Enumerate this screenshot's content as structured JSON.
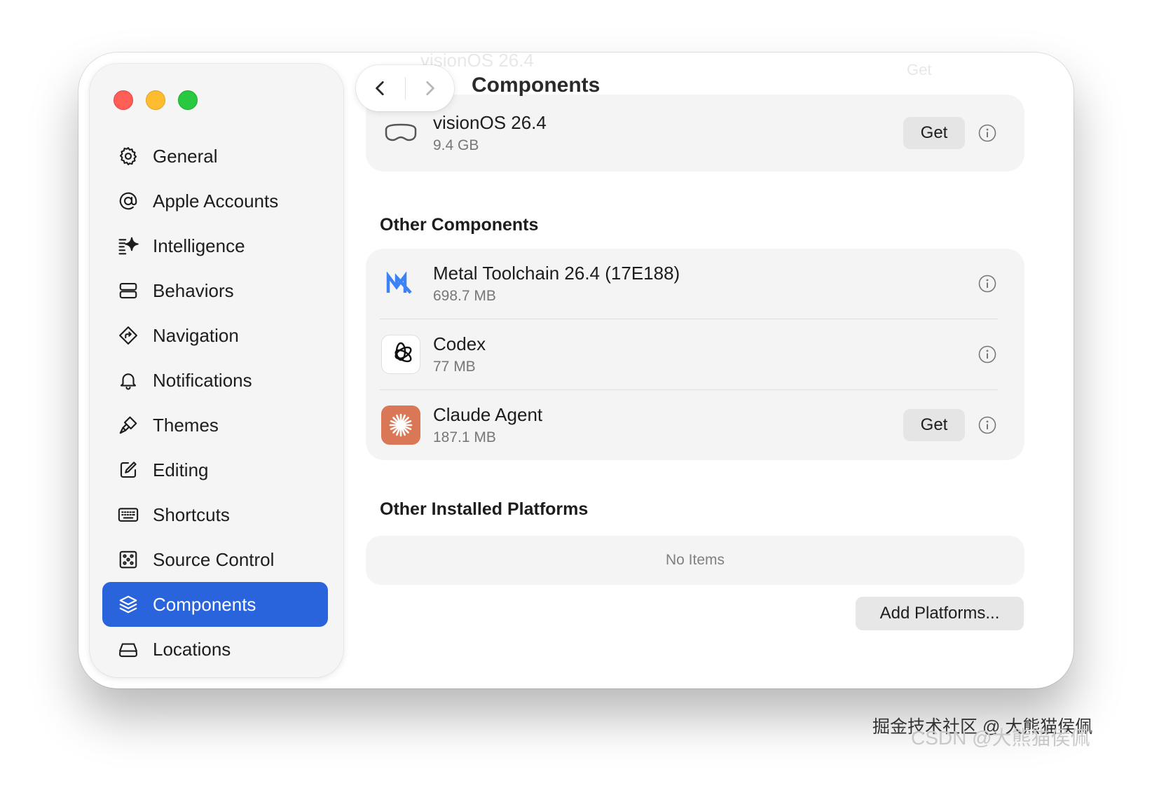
{
  "window": {
    "title": "Components"
  },
  "toolbar": {
    "back_icon": "chevron-left-icon",
    "forward_icon": "chevron-right-icon"
  },
  "sidebar": {
    "items": [
      {
        "label": "General",
        "icon": "gear-icon"
      },
      {
        "label": "Apple Accounts",
        "icon": "at-sign-icon"
      },
      {
        "label": "Intelligence",
        "icon": "sparkle-icon"
      },
      {
        "label": "Behaviors",
        "icon": "behaviors-icon"
      },
      {
        "label": "Navigation",
        "icon": "navigation-icon"
      },
      {
        "label": "Notifications",
        "icon": "bell-icon"
      },
      {
        "label": "Themes",
        "icon": "paintbrush-icon"
      },
      {
        "label": "Editing",
        "icon": "edit-icon"
      },
      {
        "label": "Shortcuts",
        "icon": "keyboard-icon"
      },
      {
        "label": "Source Control",
        "icon": "source-control-icon"
      },
      {
        "label": "Components",
        "icon": "stack-icon",
        "selected": true
      },
      {
        "label": "Locations",
        "icon": "drive-icon"
      }
    ]
  },
  "platforms": {
    "visionos": {
      "name": "visionOS 26.4",
      "size": "9.4 GB",
      "get_label": "Get"
    },
    "ghost_name": "visionOS 26.4",
    "ghost_get": "Get"
  },
  "other_components": {
    "heading": "Other Components",
    "items": [
      {
        "name": "Metal Toolchain 26.4 (17E188)",
        "size": "698.7 MB"
      },
      {
        "name": "Codex",
        "size": "77 MB"
      },
      {
        "name": "Claude Agent",
        "size": "187.1 MB",
        "get_label": "Get"
      }
    ]
  },
  "installed_platforms": {
    "heading": "Other Installed Platforms",
    "empty_text": "No Items",
    "add_label": "Add Platforms..."
  },
  "watermark": {
    "line1": "掘金技术社区 @ 大熊猫侯佩",
    "line2": "CSDN @大熊猫侯佩"
  },
  "colors": {
    "accent": "#2a64dd",
    "claude": "#d97757",
    "metal": "#3b82f6"
  }
}
